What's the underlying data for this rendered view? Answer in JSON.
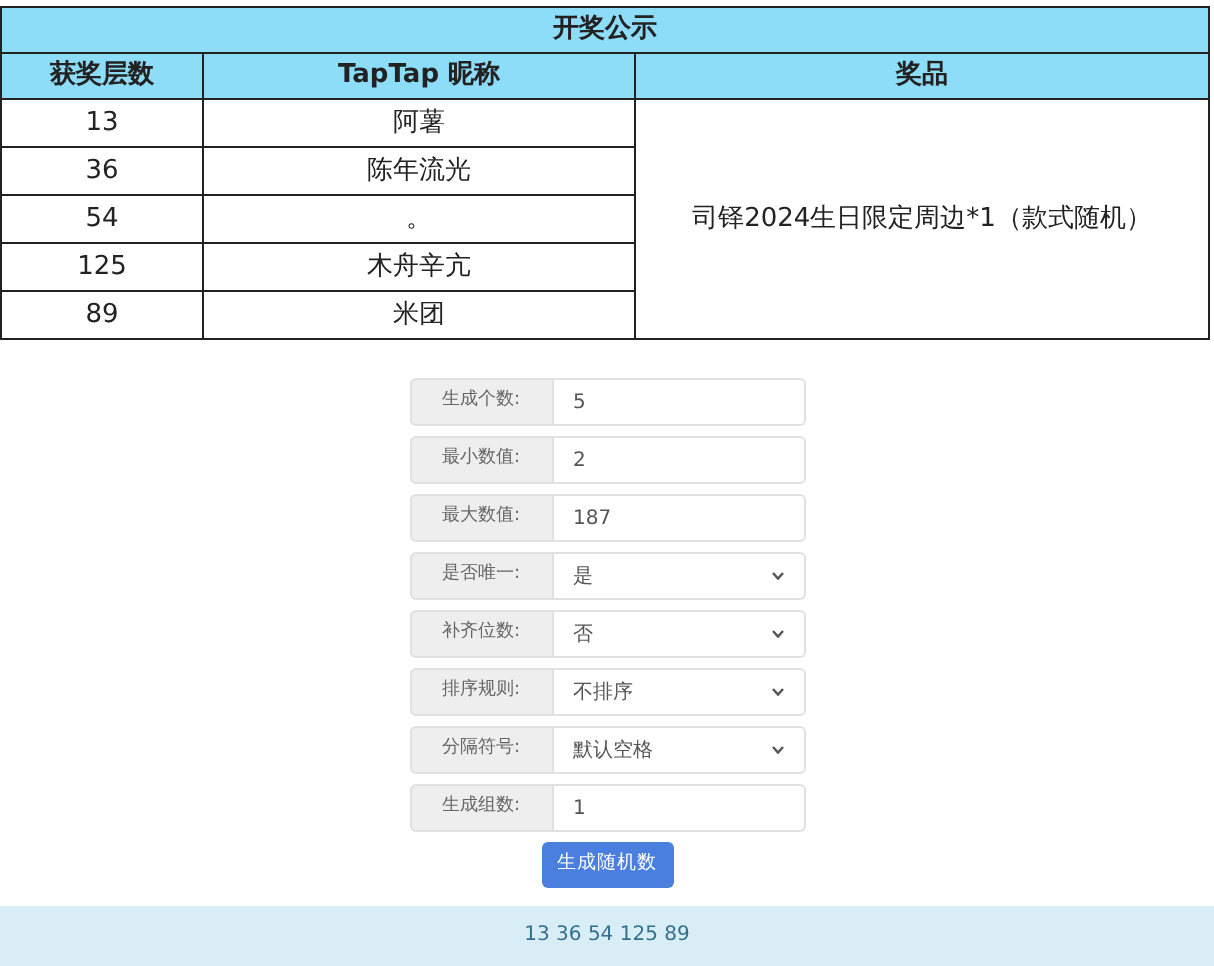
{
  "table": {
    "title": "开奖公示",
    "columns": [
      "获奖层数",
      "TapTap 昵称",
      "奖品"
    ],
    "rows": [
      {
        "floor": "13",
        "nickname": "阿薯"
      },
      {
        "floor": "36",
        "nickname": "陈年流光"
      },
      {
        "floor": "54",
        "nickname": "。"
      },
      {
        "floor": "125",
        "nickname": "木舟辛亢"
      },
      {
        "floor": "89",
        "nickname": "米团"
      }
    ],
    "prize": "司铎2024生日限定周边*1（款式随机）"
  },
  "form": {
    "fields": [
      {
        "kind": "input",
        "label": "生成个数:",
        "value": "5"
      },
      {
        "kind": "input",
        "label": "最小数值:",
        "value": "2"
      },
      {
        "kind": "input",
        "label": "最大数值:",
        "value": "187"
      },
      {
        "kind": "select",
        "label": "是否唯一:",
        "value": "是"
      },
      {
        "kind": "select",
        "label": "补齐位数:",
        "value": "否"
      },
      {
        "kind": "select",
        "label": "排序规则:",
        "value": "不排序"
      },
      {
        "kind": "select",
        "label": "分隔符号:",
        "value": "默认空格"
      },
      {
        "kind": "input",
        "label": "生成组数:",
        "value": "1"
      }
    ],
    "button": "生成随机数",
    "result": "13 36 54 125 89"
  }
}
